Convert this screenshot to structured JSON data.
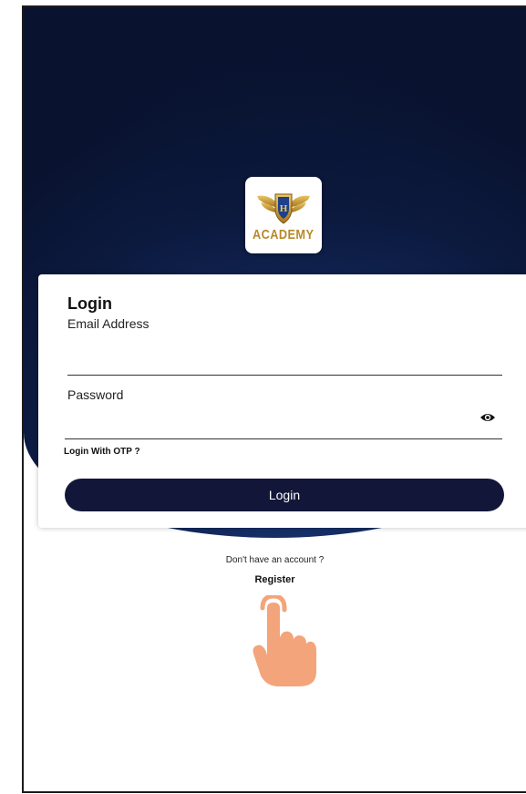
{
  "logo": {
    "text": "ACADEMY",
    "icon": "winged-shield-icon",
    "color": "#b8892a"
  },
  "login_card": {
    "title": "Login",
    "email": {
      "label": "Email Address",
      "value": "",
      "placeholder": ""
    },
    "password": {
      "label": "Password",
      "value": "",
      "placeholder": "",
      "toggle_icon": "eye-icon"
    },
    "otp_link": "Login With OTP ?",
    "submit_label": "Login"
  },
  "footer": {
    "prompt": "Don't have an account ?",
    "register_label": "Register",
    "pointer_icon": "pointing-hand-icon"
  },
  "colors": {
    "hero": "#12275a",
    "button": "#12173a",
    "hand": "#f4a47a"
  }
}
